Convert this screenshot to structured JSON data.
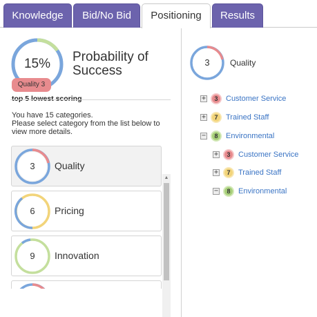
{
  "tabs": [
    {
      "label": "Knowledge",
      "active": false
    },
    {
      "label": "Bid/No Bid",
      "active": false
    },
    {
      "label": "Positioning",
      "active": true
    },
    {
      "label": "Results",
      "active": false
    }
  ],
  "probability": {
    "value_label": "15%",
    "value": 0.15,
    "title": "Probability of Success"
  },
  "lowest": {
    "label": "top 5 lowest scoring",
    "badge": "Quality 3"
  },
  "info_text": "You have 15 categories.\nPlease select category from the list below to view more details.",
  "categories": [
    {
      "score": "3",
      "label": "Quality",
      "selected": true
    },
    {
      "score": "6",
      "label": "Pricing",
      "selected": false
    },
    {
      "score": "9",
      "label": "Innovation",
      "selected": false
    }
  ],
  "detail": {
    "score": "3",
    "title": "Quality",
    "tree": [
      {
        "toggle": "+",
        "score": "3",
        "label": "Customer Service",
        "level": 0,
        "color": "red"
      },
      {
        "toggle": "+",
        "score": "7",
        "label": "Trained Staff",
        "level": 0,
        "color": "yellow"
      },
      {
        "toggle": "−",
        "score": "8",
        "label": "Environmental",
        "level": 0,
        "color": "green"
      },
      {
        "toggle": "+",
        "score": "3",
        "label": "Customer Service",
        "level": 1,
        "color": "red"
      },
      {
        "toggle": "+",
        "score": "7",
        "label": "Trained Staff",
        "level": 1,
        "color": "yellow"
      },
      {
        "toggle": "−",
        "score": "8",
        "label": "Environmental",
        "level": 1,
        "color": "green"
      }
    ]
  },
  "colors": {
    "tab_bg": "#6c63ad",
    "ring_blue": "#7aa6dc",
    "ring_track": "#e6e6e6",
    "red": "#e88b8e",
    "yellow": "#f2d47a",
    "green": "#a8d07a",
    "link": "#3a74c4"
  },
  "icons": {
    "expand": "plus-square-icon",
    "collapse": "minus-square-icon",
    "scroll_up": "arrow-up-icon"
  }
}
